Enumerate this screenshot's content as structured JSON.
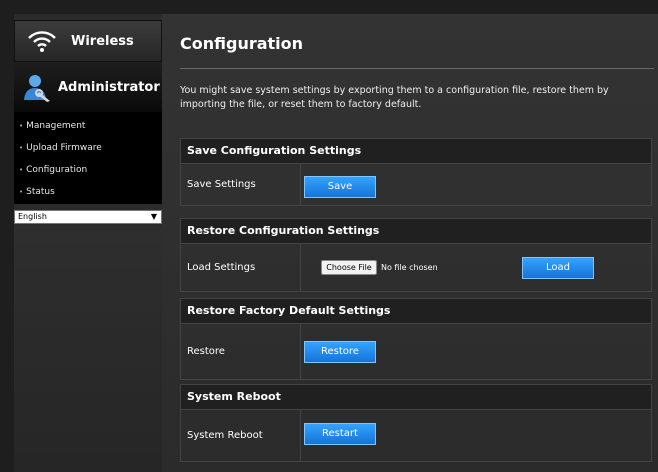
{
  "sidebar": {
    "wireless_label": "Wireless",
    "admin_label": "Administrator",
    "items": [
      {
        "label": "Management"
      },
      {
        "label": "Upload Firmware"
      },
      {
        "label": "Configuration"
      },
      {
        "label": "Status"
      }
    ],
    "language": {
      "selected": "English"
    }
  },
  "main": {
    "title": "Configuration",
    "intro": "You might save system settings by exporting them to a configuration file, restore them by importing the file, or reset them to factory default.",
    "sections": {
      "save": {
        "heading": "Save Configuration Settings",
        "label": "Save Settings",
        "button": "Save"
      },
      "restore_config": {
        "heading": "Restore Configuration Settings",
        "label": "Load Settings",
        "choose_file": "Choose File",
        "no_file": "No file chosen",
        "button": "Load"
      },
      "factory": {
        "heading": "Restore Factory Default Settings",
        "label": "Restore",
        "button": "Restore"
      },
      "reboot": {
        "heading": "System Reboot",
        "label": "System Reboot",
        "button": "Restart"
      }
    }
  },
  "colors": {
    "accent_button": "#2a8cf0",
    "section_header": "#202020",
    "background": "#2b2b2b"
  }
}
